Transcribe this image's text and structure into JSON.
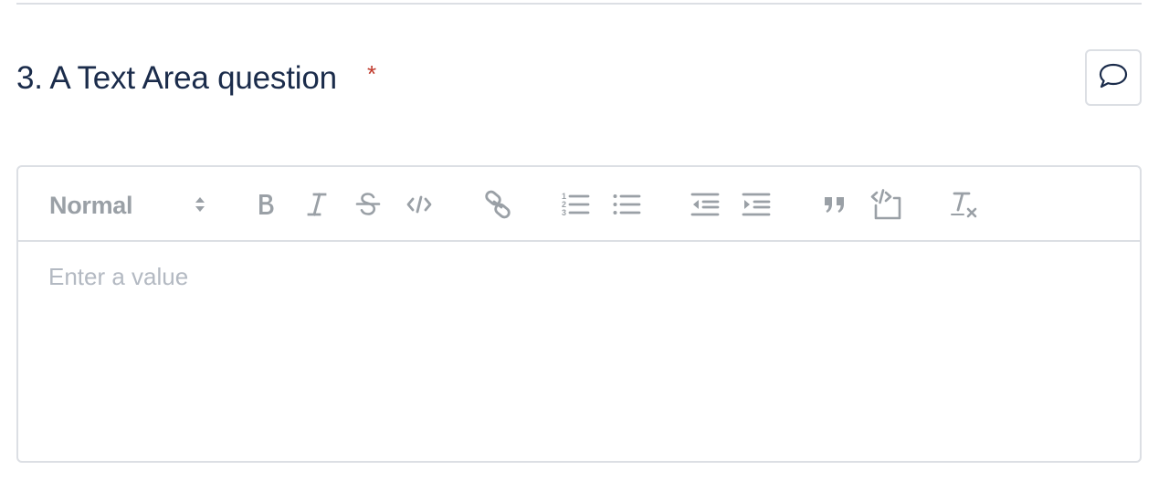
{
  "question": {
    "title": "3. A Text Area question",
    "required_marker": "*"
  },
  "editor": {
    "format_selected": "Normal",
    "placeholder": "Enter a value",
    "value": ""
  },
  "toolbar": {
    "buttons": [
      {
        "name": "bold",
        "icon": "bold-icon"
      },
      {
        "name": "italic",
        "icon": "italic-icon"
      },
      {
        "name": "strikethrough",
        "icon": "strikethrough-icon"
      },
      {
        "name": "code",
        "icon": "code-icon"
      },
      {
        "name": "link",
        "icon": "link-icon"
      },
      {
        "name": "ordered-list",
        "icon": "ordered-list-icon"
      },
      {
        "name": "bullet-list",
        "icon": "bullet-list-icon"
      },
      {
        "name": "outdent",
        "icon": "outdent-icon"
      },
      {
        "name": "indent",
        "icon": "indent-icon"
      },
      {
        "name": "blockquote",
        "icon": "blockquote-icon"
      },
      {
        "name": "code-block",
        "icon": "code-block-icon"
      },
      {
        "name": "clear-formatting",
        "icon": "clear-formatting-icon"
      }
    ]
  },
  "colors": {
    "title": "#1b2c4b",
    "required": "#c0392b",
    "border": "#dcdfe4",
    "icon": "#9aa0a6",
    "placeholder": "#b3b9c2"
  }
}
